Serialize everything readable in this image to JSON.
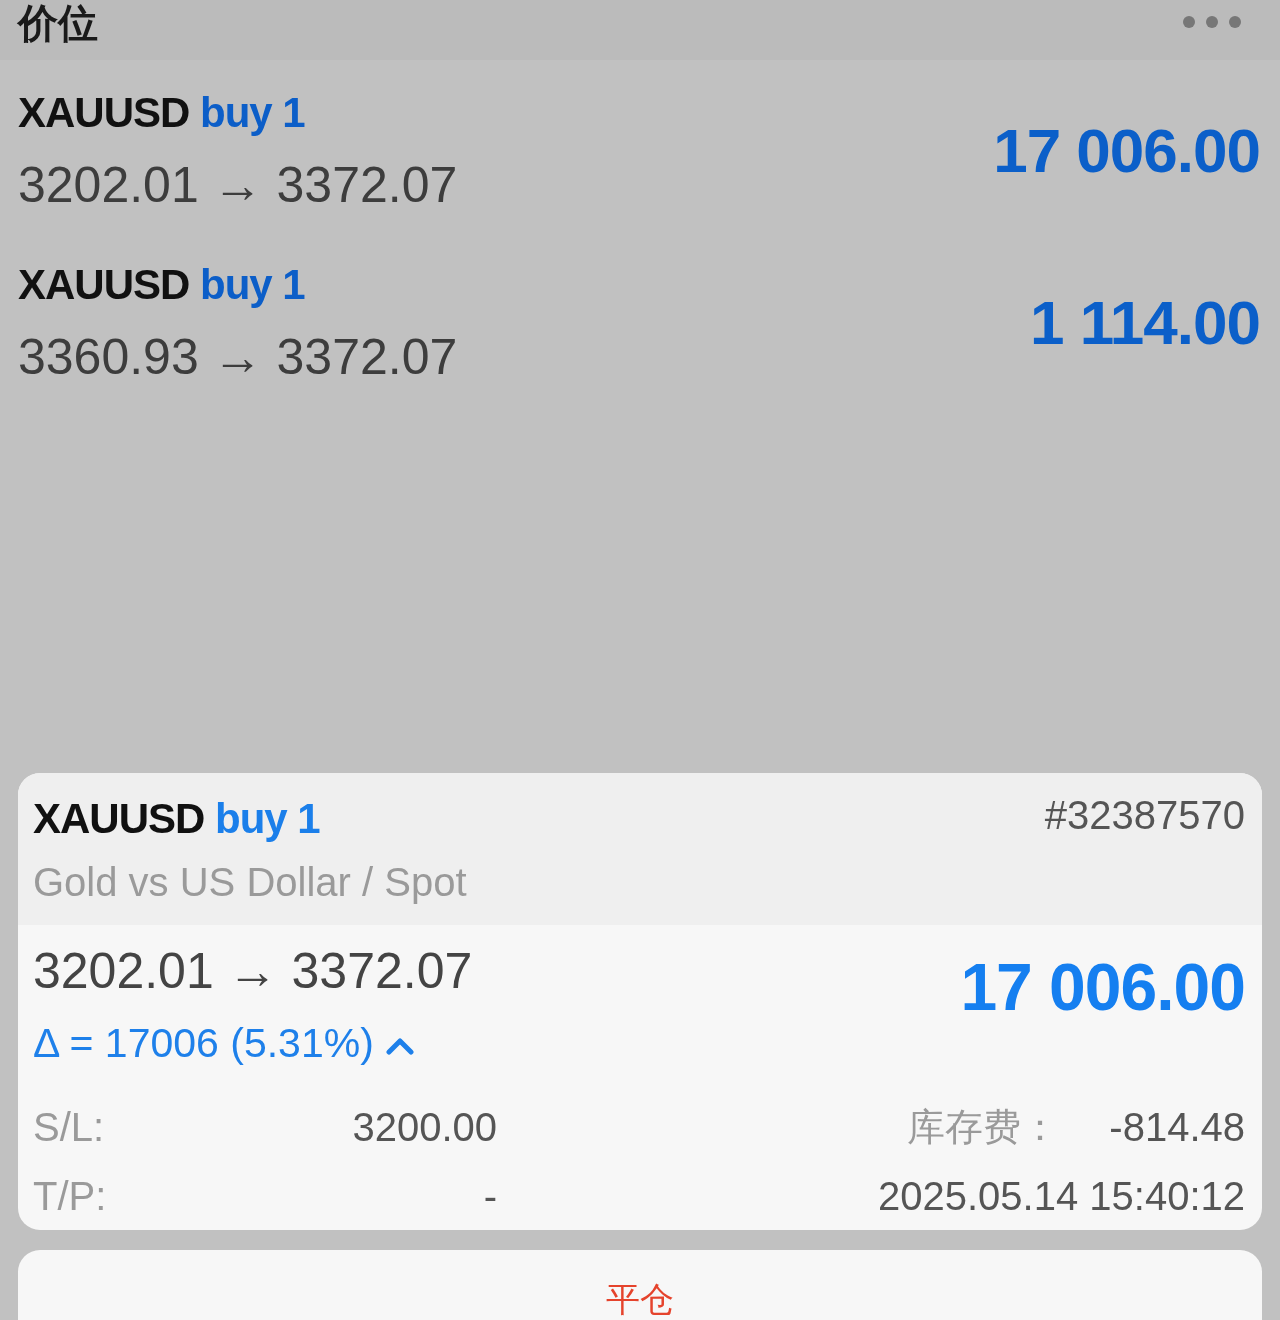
{
  "header": {
    "title": "价位"
  },
  "positions": [
    {
      "symbol": "XAUUSD",
      "side": "buy 1",
      "prices": "3202.01 → 3372.07",
      "profit": "17 006.00"
    },
    {
      "symbol": "XAUUSD",
      "side": "buy 1",
      "prices": "3360.93 → 3372.07",
      "profit": "1 114.00"
    }
  ],
  "detail": {
    "symbol": "XAUUSD",
    "side": "buy 1",
    "description": "Gold vs US Dollar / Spot",
    "ticket": "#32387570",
    "prices": "3202.01 → 3372.07",
    "delta": "Δ = 17006 (5.31%)",
    "profit": "17 006.00",
    "fields": [
      {
        "label": "S/L:",
        "value": "3200.00",
        "extra_label": "库存费：",
        "extra_value": "-814.48"
      },
      {
        "label": "T/P:",
        "value": "-",
        "extra_value": "2025.05.14 15:40:12"
      }
    ]
  },
  "close_button": {
    "label": "平仓"
  }
}
